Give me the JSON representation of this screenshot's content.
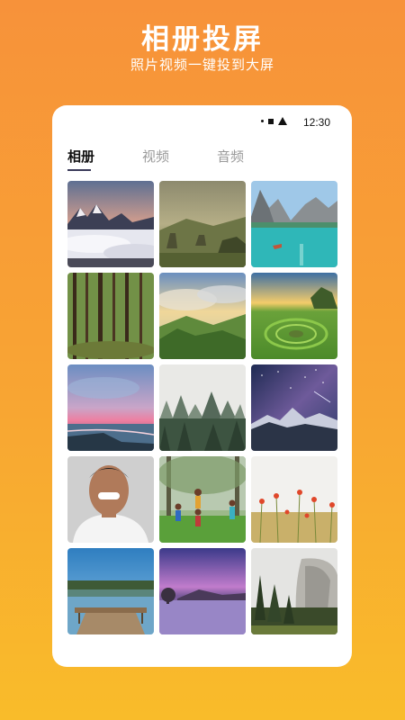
{
  "promo": {
    "title": "相册投屏",
    "subtitle": "照片视频一键投到大屏"
  },
  "status_bar": {
    "time": "12:30",
    "icons": [
      "dot-icon",
      "square-icon",
      "triangle-icon"
    ]
  },
  "tabs": [
    {
      "label": "相册",
      "active": true
    },
    {
      "label": "视频",
      "active": false
    },
    {
      "label": "音频",
      "active": false
    }
  ],
  "photos": [
    {
      "subject": "snowy-mountain-sea-of-clouds"
    },
    {
      "subject": "misty-rock-valley"
    },
    {
      "subject": "turquoise-lake-mountains"
    },
    {
      "subject": "forest-trees"
    },
    {
      "subject": "green-hills-clouds"
    },
    {
      "subject": "green-meadow-circle"
    },
    {
      "subject": "pink-sunset-beach"
    },
    {
      "subject": "foggy-pine-forest"
    },
    {
      "subject": "starry-night-mountains"
    },
    {
      "subject": "smiling-man-portrait"
    },
    {
      "subject": "children-playing-in-park"
    },
    {
      "subject": "poppy-flower-field"
    },
    {
      "subject": "lake-pier"
    },
    {
      "subject": "purple-dusk-lake"
    },
    {
      "subject": "granite-cliff-forest"
    }
  ],
  "colors": {
    "background_top": "#f7923a",
    "background_bottom": "#f9bc2a",
    "tab_active": "#111111",
    "tab_inactive": "#9a9a9a"
  }
}
